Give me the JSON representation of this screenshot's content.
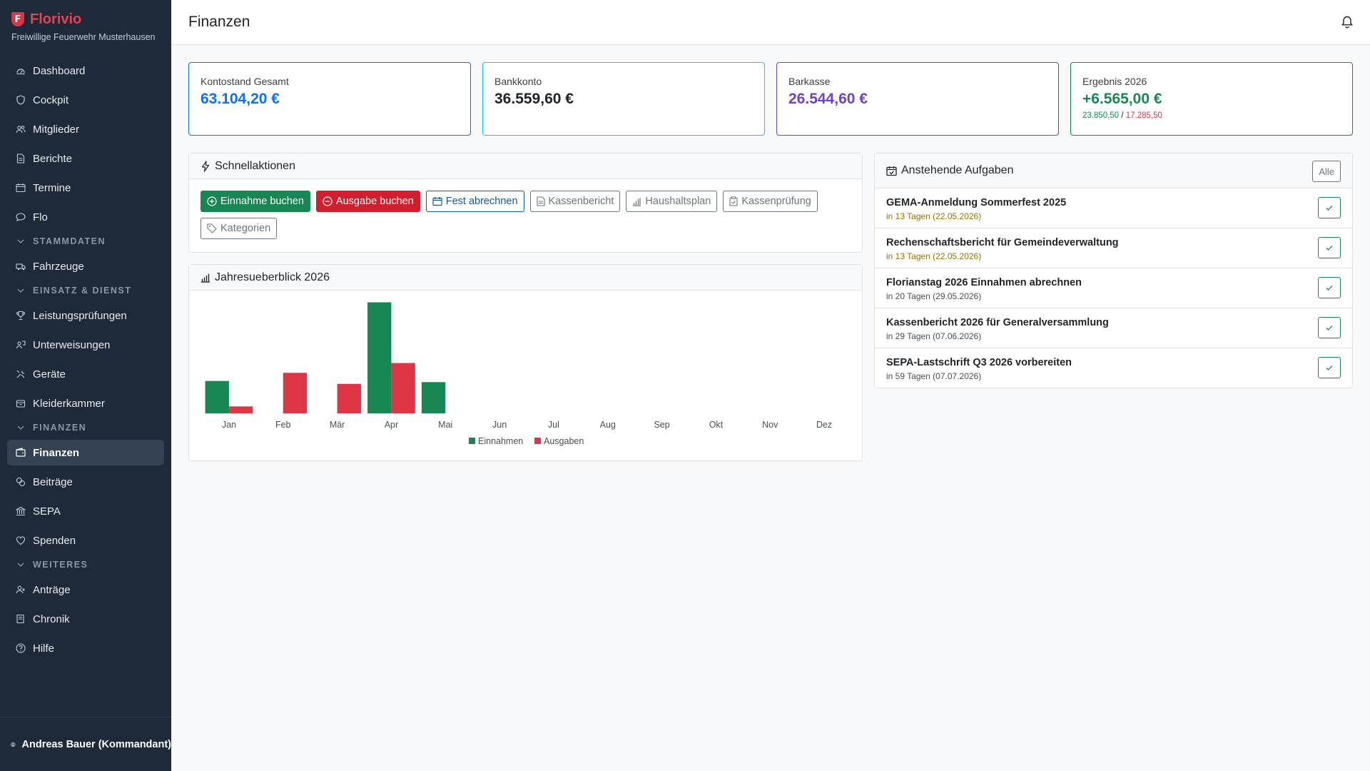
{
  "brand": {
    "logo_letter": "F",
    "name": "Florivio",
    "subtitle": "Freiwillige Feuerwehr Musterhausen"
  },
  "nav": {
    "items1": [
      {
        "label": "Dashboard",
        "icon": "dashboard-icon"
      },
      {
        "label": "Cockpit",
        "icon": "shield-icon"
      },
      {
        "label": "Mitglieder",
        "icon": "people-icon"
      },
      {
        "label": "Berichte",
        "icon": "document-icon"
      },
      {
        "label": "Termine",
        "icon": "calendar-icon"
      },
      {
        "label": "Flo",
        "icon": "chat-icon"
      }
    ],
    "section_stammdaten": "STAMMDATEN",
    "fahrzeuge": "Fahrzeuge",
    "section_einsatz": "EINSATZ & DIENST",
    "items2": [
      {
        "label": "Leistungsprüfungen",
        "icon": "trophy-icon"
      },
      {
        "label": "Unterweisungen",
        "icon": "person-board-icon"
      },
      {
        "label": "Geräte",
        "icon": "tools-icon"
      },
      {
        "label": "Kleiderkammer",
        "icon": "box-icon"
      }
    ],
    "section_finanzen": "FINANZEN",
    "items3": [
      {
        "label": "Finanzen",
        "icon": "wallet-icon",
        "active": true
      },
      {
        "label": "Beiträge",
        "icon": "coins-icon"
      },
      {
        "label": "SEPA",
        "icon": "bank-icon"
      },
      {
        "label": "Spenden",
        "icon": "heart-icon"
      }
    ],
    "section_weiteres": "WEITERES",
    "items4": [
      {
        "label": "Anträge",
        "icon": "person-add-icon"
      },
      {
        "label": "Chronik",
        "icon": "book-icon"
      },
      {
        "label": "Hilfe",
        "icon": "help-icon"
      }
    ]
  },
  "user": {
    "name": "Andreas Bauer (Kommandant)"
  },
  "header": {
    "title": "Finanzen"
  },
  "stats": {
    "total": {
      "label": "Kontostand Gesamt",
      "value": "63.104,20 €",
      "color": "#0d6efd",
      "border": "#0d6efd"
    },
    "bank": {
      "label": "Bankkonto",
      "value": "36.559,60 €",
      "color": "#212529",
      "border": "#0dcaf0"
    },
    "cash": {
      "label": "Barkasse",
      "value": "26.544,60 €",
      "color": "#6f42c1",
      "border": "#6f42c1"
    },
    "result": {
      "label": "Ergebnis 2026",
      "value": "+6.565,00 €",
      "income": "23.850,50",
      "sep": " / ",
      "expense": "17.285,50",
      "color": "#198754",
      "border": "#198754"
    }
  },
  "quick_actions": {
    "title": "Schnellaktionen",
    "buttons": {
      "income": "Einnahme buchen",
      "expense": "Ausgabe buchen",
      "fest": "Fest abrechnen",
      "kassenbericht": "Kassenbericht",
      "haushaltsplan": "Haushaltsplan",
      "kassenpruefung": "Kassenprüfung",
      "kategorien": "Kategorien"
    }
  },
  "chart_data": {
    "type": "bar",
    "title": "Jahresueberblick 2026",
    "categories": [
      "Jan",
      "Feb",
      "Mär",
      "Apr",
      "Mai",
      "Jun",
      "Jul",
      "Aug",
      "Sep",
      "Okt",
      "Nov",
      "Dez"
    ],
    "series": [
      {
        "name": "Einnahmen",
        "color": "#198754",
        "values": [
          2800,
          0,
          0,
          9600,
          2700,
          0,
          0,
          0,
          0,
          0,
          0,
          0
        ]
      },
      {
        "name": "Ausgaben",
        "color": "#dc3545",
        "values": [
          600,
          3500,
          2550,
          4350,
          0,
          0,
          0,
          0,
          0,
          0,
          0,
          0
        ]
      }
    ],
    "ylim": [
      0,
      10000
    ],
    "grid": false,
    "legend": "bottom"
  },
  "tasks": {
    "title": "Anstehende Aufgaben",
    "all_label": "Alle",
    "items": [
      {
        "title": "GEMA-Anmeldung Sommerfest 2025",
        "due": "in 13 Tagen (22.05.2026)",
        "due_color": "#997404"
      },
      {
        "title": "Rechenschaftsbericht für Gemeindeverwaltung",
        "due": "in 13 Tagen (22.05.2026)",
        "due_color": "#997404"
      },
      {
        "title": "Florianstag 2026 Einnahmen abrechnen",
        "due": "in 20 Tagen (29.05.2026)",
        "due_color": "#495057"
      },
      {
        "title": "Kassenbericht 2026 für Generalversammlung",
        "due": "in 29 Tagen (07.06.2026)",
        "due_color": "#495057"
      },
      {
        "title": "SEPA-Lastschrift Q3 2026 vorbereiten",
        "due": "in 59 Tagen (07.07.2026)",
        "due_color": "#495057"
      }
    ]
  }
}
